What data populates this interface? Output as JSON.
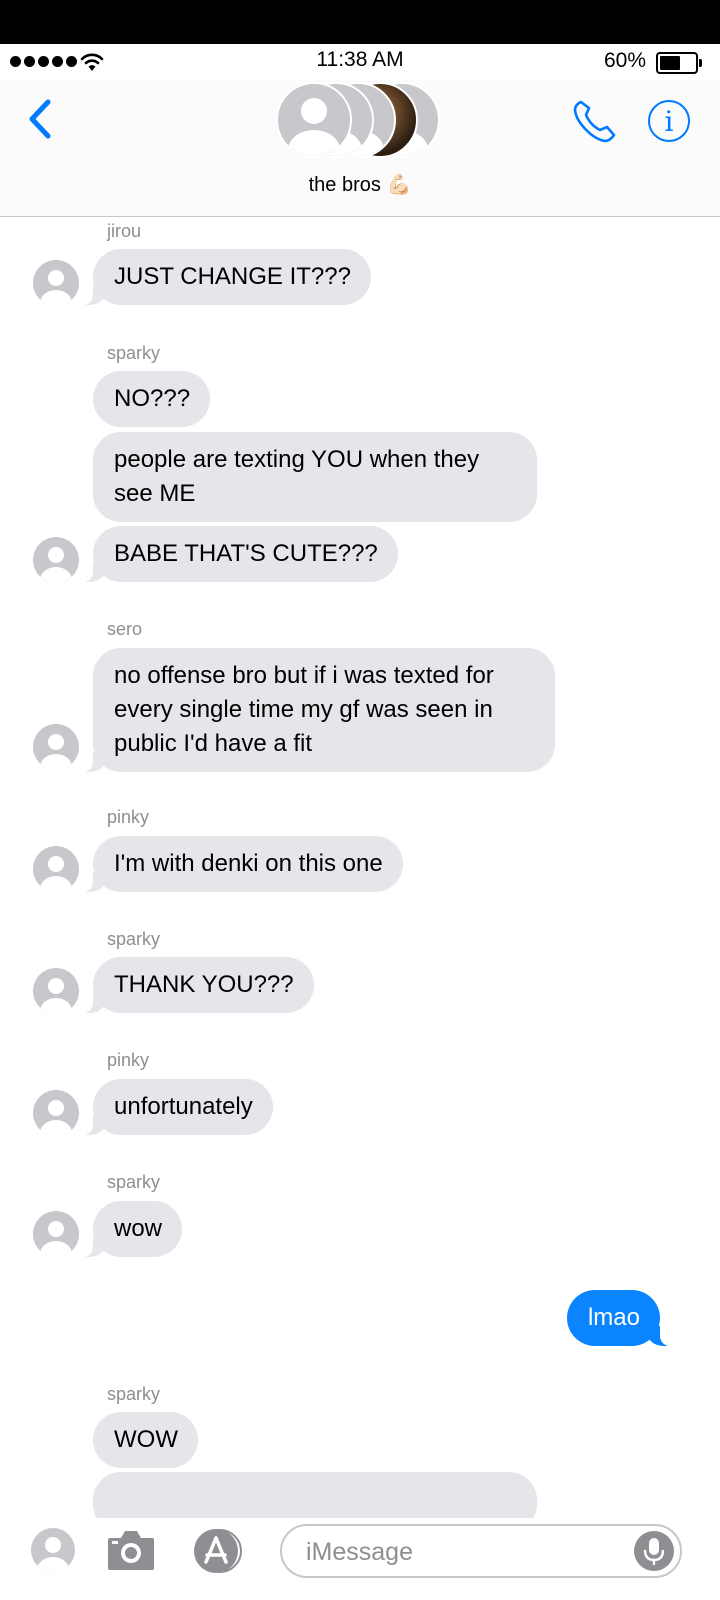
{
  "status_bar": {
    "time": "11:38 AM",
    "battery": "60%"
  },
  "header": {
    "group_name": "the bros 💪🏻"
  },
  "messages": [
    {
      "sender": "jirou",
      "text": "JUST CHANGE IT???"
    },
    {
      "sender": "sparky",
      "text": "NO???"
    },
    {
      "text": "people are texting YOU when they see ME"
    },
    {
      "text": "BABE THAT'S CUTE???"
    },
    {
      "sender": "sero",
      "text": "no offense bro but if i was texted for every single time my gf was seen in public I'd have a fit"
    },
    {
      "sender": "pinky",
      "text": "I'm with denki on this one"
    },
    {
      "sender": "sparky",
      "text": "THANK YOU???"
    },
    {
      "sender": "pinky",
      "text": "unfortunately"
    },
    {
      "sender": "sparky",
      "text": "wow"
    },
    {
      "text": "lmao",
      "outgoing": true
    },
    {
      "sender": "sparky",
      "text": "WOW"
    }
  ],
  "composer": {
    "placeholder": "iMessage"
  },
  "colors": {
    "accent": "#007aff",
    "incoming_bubble": "#e5e5ea",
    "outgoing_bubble": "#0a84ff"
  }
}
